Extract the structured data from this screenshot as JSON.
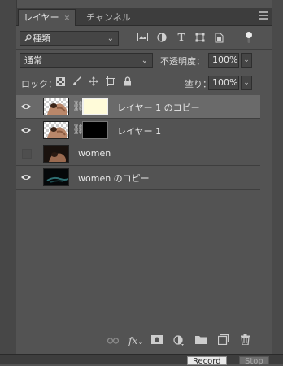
{
  "tabs": [
    {
      "label": "レイヤー",
      "active": true
    },
    {
      "label": "チャンネル",
      "active": false
    }
  ],
  "filter": {
    "kind_label": "種類"
  },
  "blend": {
    "mode": "通常",
    "opacity_label": "不透明度：",
    "opacity_value": "100%"
  },
  "lock": {
    "label": "ロック：",
    "fill_label": "塗り：",
    "fill_value": "100%"
  },
  "layers": [
    {
      "name": "レイヤー 1 のコピー",
      "visible": true,
      "selected": true,
      "has_mask": true,
      "mask_color": "#fffbd9"
    },
    {
      "name": "レイヤー 1",
      "visible": true,
      "selected": false,
      "has_mask": true,
      "mask_color": "#000000"
    },
    {
      "name": "women",
      "visible": false,
      "selected": false,
      "has_mask": false
    },
    {
      "name": "women のコピー",
      "visible": true,
      "selected": false,
      "has_mask": false
    }
  ],
  "bottom_icons": [
    "link-icon",
    "fx-icon",
    "mask-icon",
    "adjustment-icon",
    "folder-icon",
    "new-layer-icon",
    "trash-icon"
  ],
  "statusbar": {
    "record_label": "Record",
    "stop_label": "Stop"
  },
  "colors": {
    "panel": "#535353",
    "selected_row": "#6a6a6a",
    "tabbar": "#3d3d3d"
  }
}
